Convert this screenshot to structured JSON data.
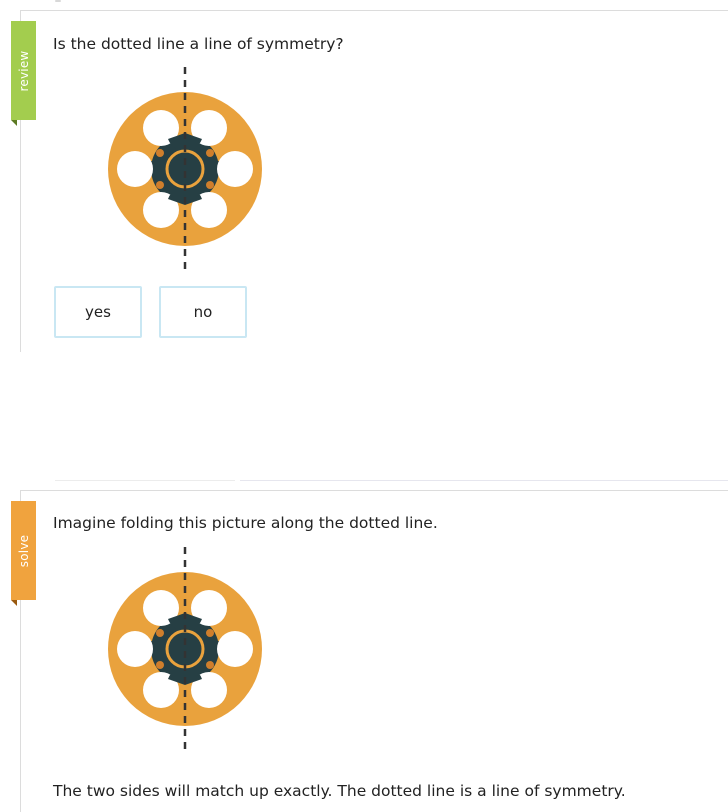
{
  "review": {
    "tag": "review",
    "question": "Is the dotted line a line of symmetry?",
    "choices": [
      "yes",
      "no"
    ],
    "tag_color": "#a3cd4e"
  },
  "solve": {
    "tag": "solve",
    "intro": "Imagine folding this picture along the dotted line.",
    "conclusion": "The two sides will match up exactly. The dotted line is a line of symmetry.",
    "tag_color": "#f0a33e"
  },
  "figure": {
    "icon": "film-reel-icon",
    "reel_color": "#e9a23d",
    "hub_color": "#263f44",
    "hole_color": "#ffffff",
    "bolt_color": "#cf7e2c",
    "fold_highlight_color": "#f6c98a",
    "line_color": "#333333"
  }
}
